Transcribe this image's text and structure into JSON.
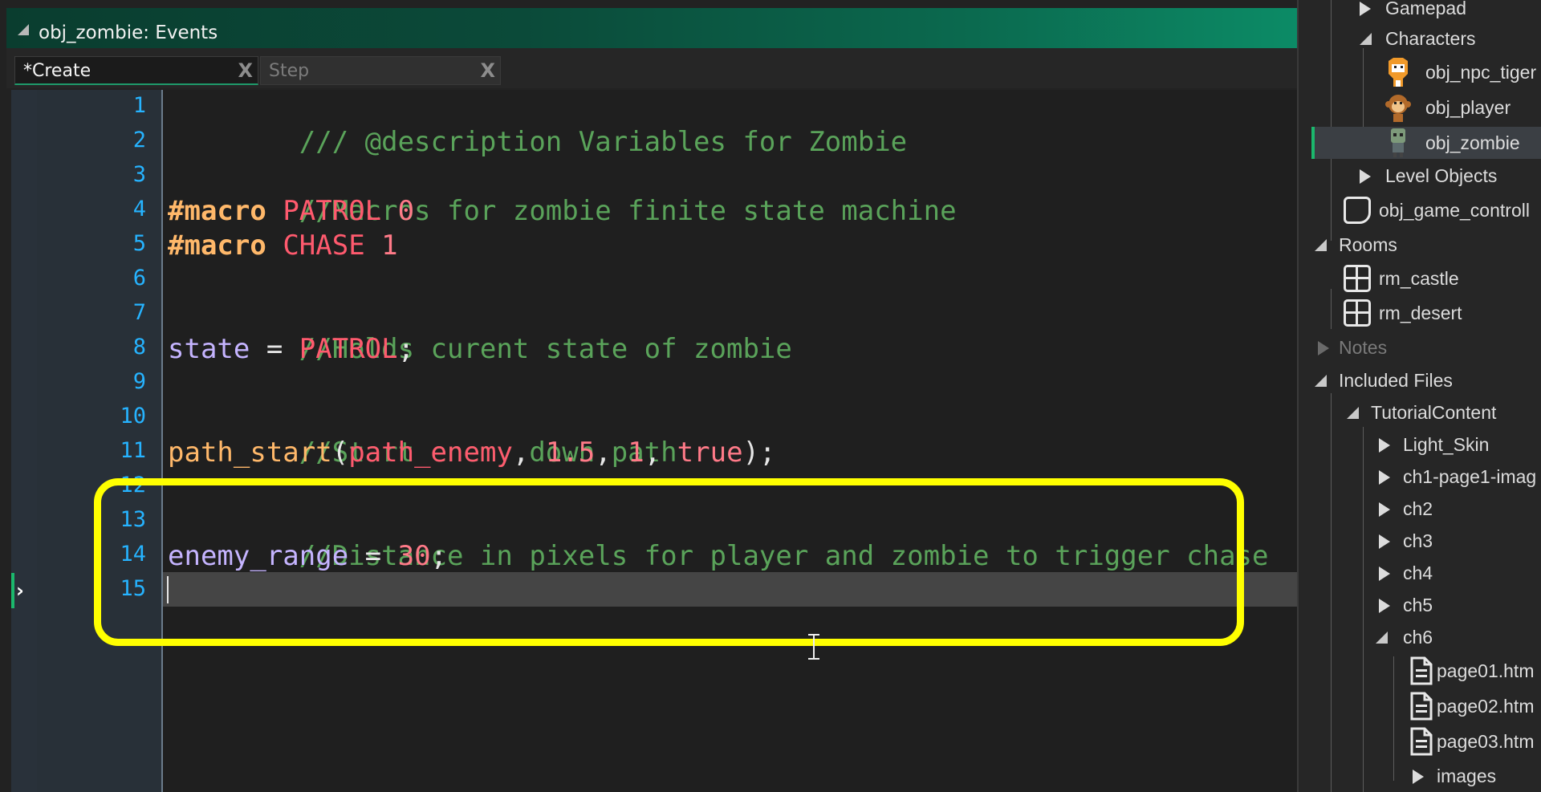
{
  "window": {
    "title": "obj_zombie: Events"
  },
  "tabs": [
    {
      "label": "*Create",
      "close": "X",
      "active": true
    },
    {
      "label": "Step",
      "close": "X",
      "active": false
    }
  ],
  "code": {
    "line_numbers": [
      "1",
      "2",
      "3",
      "4",
      "5",
      "6",
      "7",
      "8",
      "9",
      "10",
      "11",
      "12",
      "13",
      "14",
      "15"
    ],
    "line1": "/// @description Variables for Zombie",
    "line3": "//Macros for zombie finite state machine",
    "line4": {
      "kw": "#macro",
      "name": "PATROL",
      "value": "0"
    },
    "line5": {
      "kw": "#macro",
      "name": "CHASE",
      "value": "1"
    },
    "line7": "//Holds curent state of zombie",
    "line8": {
      "var": "state",
      "op": " = ",
      "const": "PATROL",
      "end": ";"
    },
    "line10": "//Start enemy down path",
    "line11": {
      "func": "path_start",
      "open": "(",
      "arg1": "path_enemy",
      "sep1": ", ",
      "arg2": "1.5",
      "sep2": ", ",
      "arg3": "1",
      "sep3": ", ",
      "arg4": "true",
      "close": ");"
    },
    "line13": "//Distance in pixels for player and zombie to trigger chase",
    "line14": {
      "var": "enemy_range",
      "op": " = ",
      "num": "30",
      "end": ";"
    },
    "current_line": 15
  },
  "colors": {
    "highlight_box": "#ffff00",
    "comment": "#5aa35a",
    "keyword": "#ffb86a",
    "constant": "#ff5a6e",
    "variable": "#c5b4ff",
    "line_number": "#26b3ff"
  },
  "resource_tree": {
    "gamepad": "Gamepad",
    "characters": "Characters",
    "npc_tiger": "obj_npc_tiger",
    "player": "obj_player",
    "zombie": "obj_zombie",
    "level_objects": "Level Objects",
    "game_controller": "obj_game_controll",
    "rooms": "Rooms",
    "rm_castle": "rm_castle",
    "rm_desert": "rm_desert",
    "notes": "Notes",
    "included_files": "Included Files",
    "tutorial_content": "TutorialContent",
    "light_skin": "Light_Skin",
    "ch1_page1": "ch1-page1-imag",
    "ch2": "ch2",
    "ch3": "ch3",
    "ch4": "ch4",
    "ch5": "ch5",
    "ch6": "ch6",
    "page01": "page01.htm",
    "page02": "page02.htm",
    "page03": "page03.htm",
    "images": "images"
  }
}
